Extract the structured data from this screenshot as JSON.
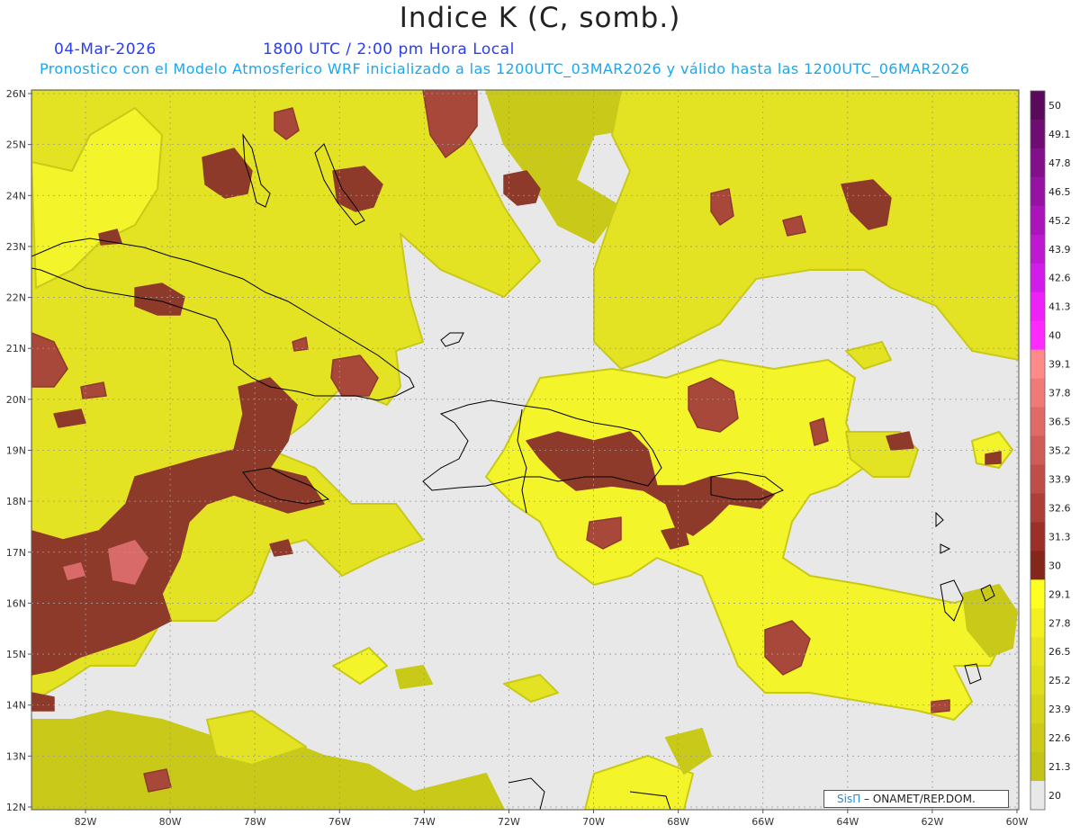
{
  "header": {
    "title": "Indice K (C, somb.)",
    "date": "04-Mar-2026",
    "time": "1800 UTC / 2:00 pm Hora Local",
    "forecast_note": "Pronostico con el Modelo Atmosferico WRF inicializado a las 1200UTC_03MAR2026 y válido hasta las  1200UTC_06MAR2026"
  },
  "axes": {
    "lat_labels": [
      "26N",
      "25N",
      "24N",
      "23N",
      "22N",
      "21N",
      "20N",
      "19N",
      "18N",
      "17N",
      "16N",
      "15N",
      "14N",
      "13N",
      "12N"
    ],
    "lon_labels": [
      "82W",
      "80W",
      "78W",
      "76W",
      "74W",
      "72W",
      "70W",
      "68W",
      "66W",
      "64W",
      "62W",
      "60W"
    ]
  },
  "colorbar": {
    "labels": [
      "50",
      "49.1",
      "47.8",
      "46.5",
      "45.2",
      "43.9",
      "42.6",
      "41.3",
      "40",
      "39.1",
      "37.8",
      "36.5",
      "35.2",
      "33.9",
      "32.6",
      "31.3",
      "30",
      "29.1",
      "27.8",
      "26.5",
      "25.2",
      "23.9",
      "22.6",
      "21.3",
      "20"
    ],
    "colors": [
      "#5a0a5a",
      "#6e0c72",
      "#82108a",
      "#9612a2",
      "#aa14ba",
      "#be18d2",
      "#d21cea",
      "#ee22f8",
      "#ff2aff",
      "#ff8a8a",
      "#f07a78",
      "#e06a66",
      "#d05c58",
      "#bf4e48",
      "#ad3e38",
      "#9a3028",
      "#85261a",
      "#ffff20",
      "#f4f020",
      "#e8e420",
      "#dede1c",
      "#d4d41a",
      "#cccc18",
      "#c4c416",
      "#e8e8e8"
    ]
  },
  "map": {
    "colors": {
      "background": "#e8e8e8",
      "yellow_low": "#c9c91a",
      "yellow_mid": "#e3e324",
      "yellow_high": "#f4f42a",
      "brown": "#8e3a2a",
      "brown_light": "#a8483a",
      "pink": "#d86a6a",
      "coast": "#000000",
      "grid": "#9a9a9a"
    }
  },
  "credit": {
    "brand": "SisΠ",
    "text": " – ONAMET/REP.DOM."
  }
}
